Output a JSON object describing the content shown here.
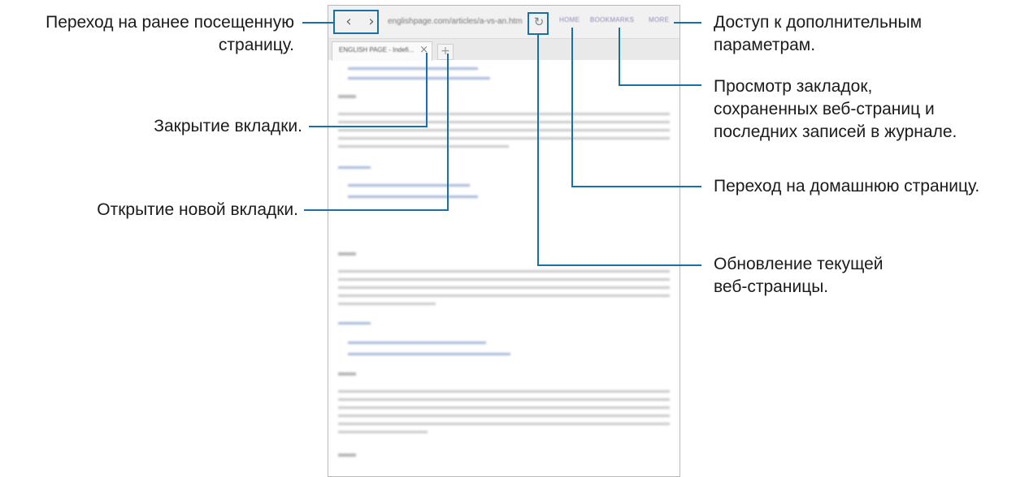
{
  "browser": {
    "url": "englishpage.com/articles/a-vs-an.htm",
    "menu": [
      "HOME",
      "BOOKMARKS",
      "MORE"
    ],
    "tab_title": "ENGLISH PAGE - Indefi..."
  },
  "callouts": {
    "back_forward": [
      "Переход на ранее посещенную",
      "страницу."
    ],
    "close_tab": "Закрытие вкладки.",
    "new_tab": "Открытие новой вкладки.",
    "more": [
      "Доступ к дополнительным",
      "параметрам."
    ],
    "bookmarks": [
      "Просмотр закладок,",
      "сохраненных веб-страниц и",
      "последних записей в журнале."
    ],
    "home": "Переход на домашнюю страницу.",
    "refresh": [
      "Обновление текущей",
      "веб-страницы."
    ]
  },
  "colors": {
    "callout_line": "#1a6fa6"
  }
}
